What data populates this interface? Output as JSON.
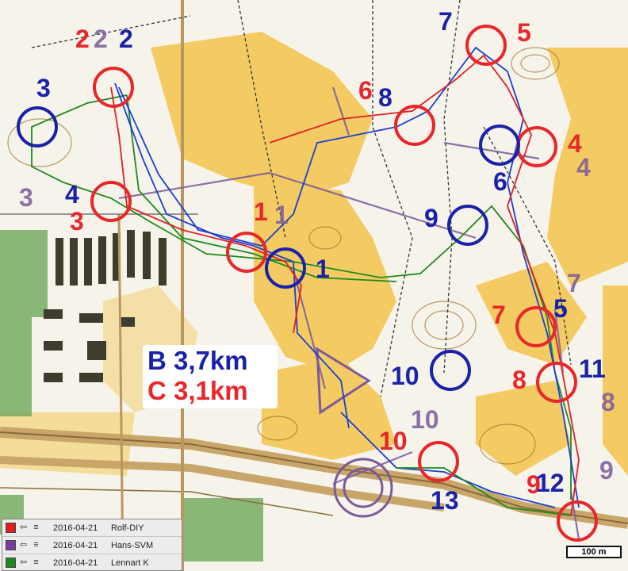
{
  "map": {
    "legend": {
      "course_b": "B 3,7km",
      "course_c": "C 3,1km"
    },
    "scale_label": "100 m",
    "colors": {
      "course_b": "#1a23a8",
      "course_c": "#e8272a",
      "course_other": "#7a5a9a",
      "route_green": "#1e8a1e",
      "route_blue": "#1b3fd0",
      "route_red": "#e02020",
      "forest_open": "#f4c542",
      "forest_green": "#6fa85a"
    },
    "controls_b": [
      "1",
      "2",
      "3",
      "4",
      "5",
      "6",
      "7",
      "8",
      "9",
      "10",
      "11",
      "12",
      "13"
    ],
    "controls_c": [
      "1",
      "2",
      "3",
      "4",
      "5",
      "6",
      "7",
      "8",
      "9",
      "10"
    ],
    "controls_other": [
      "1",
      "2",
      "3",
      "4",
      "7",
      "8",
      "9",
      "10"
    ],
    "start_symbol": "triangle",
    "finish_symbol": "double-circle"
  },
  "runners": [
    {
      "date": "2016-04-21",
      "name": "Rolf-DIY",
      "color": "#e02020",
      "icon": "route-icon"
    },
    {
      "date": "2016-04-21",
      "name": "Hans-SVM",
      "color": "#7a3aa0",
      "icon": "route-icon"
    },
    {
      "date": "2016-04-21",
      "name": "Lennart K",
      "color": "#1e8a1e",
      "icon": "route-icon"
    }
  ]
}
